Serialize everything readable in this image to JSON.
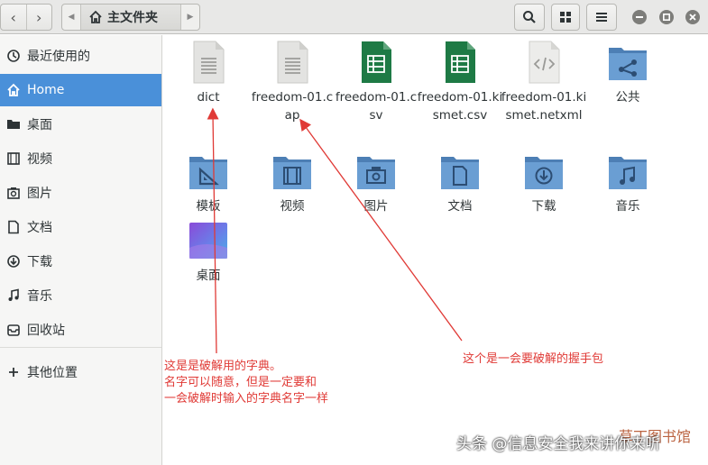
{
  "header": {
    "path_label": "主文件夹",
    "back_glyph": "‹",
    "forward_glyph": "›"
  },
  "sidebar": {
    "items": [
      {
        "label": "最近使用的",
        "icon": "recent-icon"
      },
      {
        "label": "Home",
        "icon": "home-icon",
        "active": true
      },
      {
        "label": "桌面",
        "icon": "folder-icon"
      },
      {
        "label": "视频",
        "icon": "video-icon"
      },
      {
        "label": "图片",
        "icon": "picture-icon"
      },
      {
        "label": "文档",
        "icon": "document-icon"
      },
      {
        "label": "下载",
        "icon": "download-icon"
      },
      {
        "label": "音乐",
        "icon": "music-icon"
      },
      {
        "label": "回收站",
        "icon": "trash-icon"
      },
      {
        "label": "其他位置",
        "icon": "plus-icon"
      }
    ]
  },
  "files": [
    {
      "label": "dict",
      "icon": "text-file-icon"
    },
    {
      "label": "freedom-01.cap",
      "icon": "text-file-icon"
    },
    {
      "label": "freedom-01.csv",
      "icon": "spreadsheet-icon"
    },
    {
      "label": "freedom-01.kismet.csv",
      "icon": "spreadsheet-icon"
    },
    {
      "label": "freedom-01.kismet.netxml",
      "icon": "xml-file-icon"
    },
    {
      "label": "公共",
      "icon": "public-folder-icon"
    },
    {
      "label": "模板",
      "icon": "templates-folder-icon"
    },
    {
      "label": "视频",
      "icon": "video-folder-icon"
    },
    {
      "label": "图片",
      "icon": "pictures-folder-icon"
    },
    {
      "label": "文档",
      "icon": "documents-folder-icon"
    },
    {
      "label": "下载",
      "icon": "downloads-folder-icon"
    },
    {
      "label": "音乐",
      "icon": "music-folder-icon"
    },
    {
      "label": "桌面",
      "icon": "desktop-folder-icon"
    }
  ],
  "annotations": {
    "dict_note": [
      "这是是破解用的字典。",
      "名字可以随意，但是一定要和",
      "一会破解时输入的字典名字一样"
    ],
    "cap_note": "这个是一会要破解的握手包"
  },
  "watermark": {
    "text": "头条 @信息安全我来讲你来听",
    "text2": "草丁图书馆"
  },
  "colors": {
    "accent": "#4a90d9",
    "folder": "#5b8fc6",
    "spreadsheet": "#1e7a45",
    "annotation": "#e03a36"
  }
}
